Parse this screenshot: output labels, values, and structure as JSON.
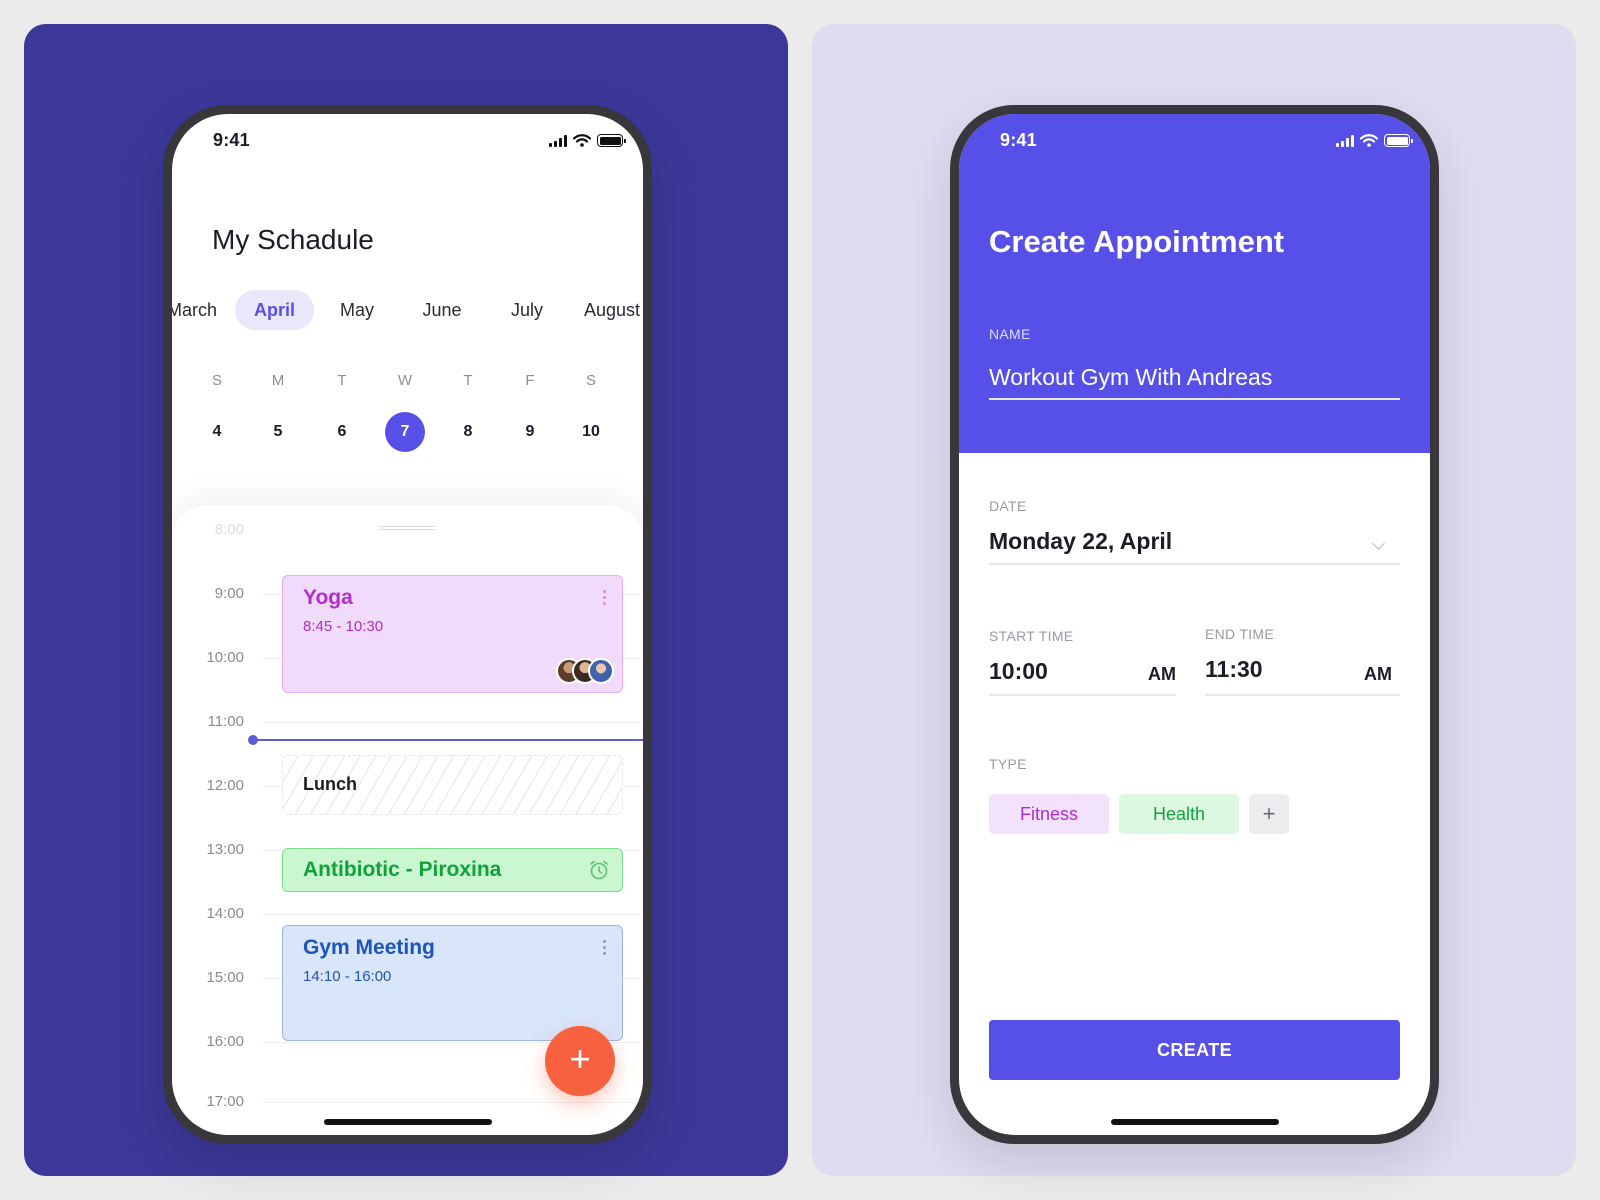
{
  "colors": {
    "left_panel_bg": "#3c3899",
    "right_panel_bg": "#dfdcf1",
    "accent": "#5750e8",
    "fab": "#f7613f",
    "yoga": "#b12dcd",
    "antibiotic": "#12a23a",
    "gym": "#1d55b8"
  },
  "schedule": {
    "status_time": "9:41",
    "title": "My Schadule",
    "months": [
      "March",
      "April",
      "May",
      "June",
      "July",
      "August"
    ],
    "selected_month": "April",
    "weekdays": [
      "S",
      "M",
      "T",
      "W",
      "T",
      "F",
      "S"
    ],
    "dates": [
      "4",
      "5",
      "6",
      "7",
      "8",
      "9",
      "10"
    ],
    "selected_date": "7",
    "hours": [
      "8:00",
      "9:00",
      "10:00",
      "11:00",
      "12:00",
      "13:00",
      "14:00",
      "15:00",
      "16:00",
      "17:00"
    ],
    "events": {
      "yoga": {
        "title": "Yoga",
        "time": "8:45 - 10:30",
        "icon": "more-vertical-icon"
      },
      "lunch": {
        "title": "Lunch"
      },
      "antibiotic": {
        "title": "Antibiotic - Piroxina",
        "icon": "alarm-clock-icon"
      },
      "gym": {
        "title": "Gym Meeting",
        "time": "14:10 - 16:00",
        "icon": "more-vertical-icon"
      }
    },
    "fab_label": "+"
  },
  "appointment": {
    "status_time": "9:41",
    "title": "Create Appointment",
    "name_label": "NAME",
    "name_value": "Workout Gym With Andreas",
    "date_label": "DATE",
    "date_value": "Monday 22, April",
    "start_label": "START TIME",
    "start_value": "10:00",
    "start_ampm": "AM",
    "end_label": "END TIME",
    "end_value": "11:30",
    "end_ampm": "AM",
    "type_label": "TYPE",
    "types": [
      "Fitness",
      "Health"
    ],
    "add_type": "+",
    "create_label": "CREATE"
  }
}
